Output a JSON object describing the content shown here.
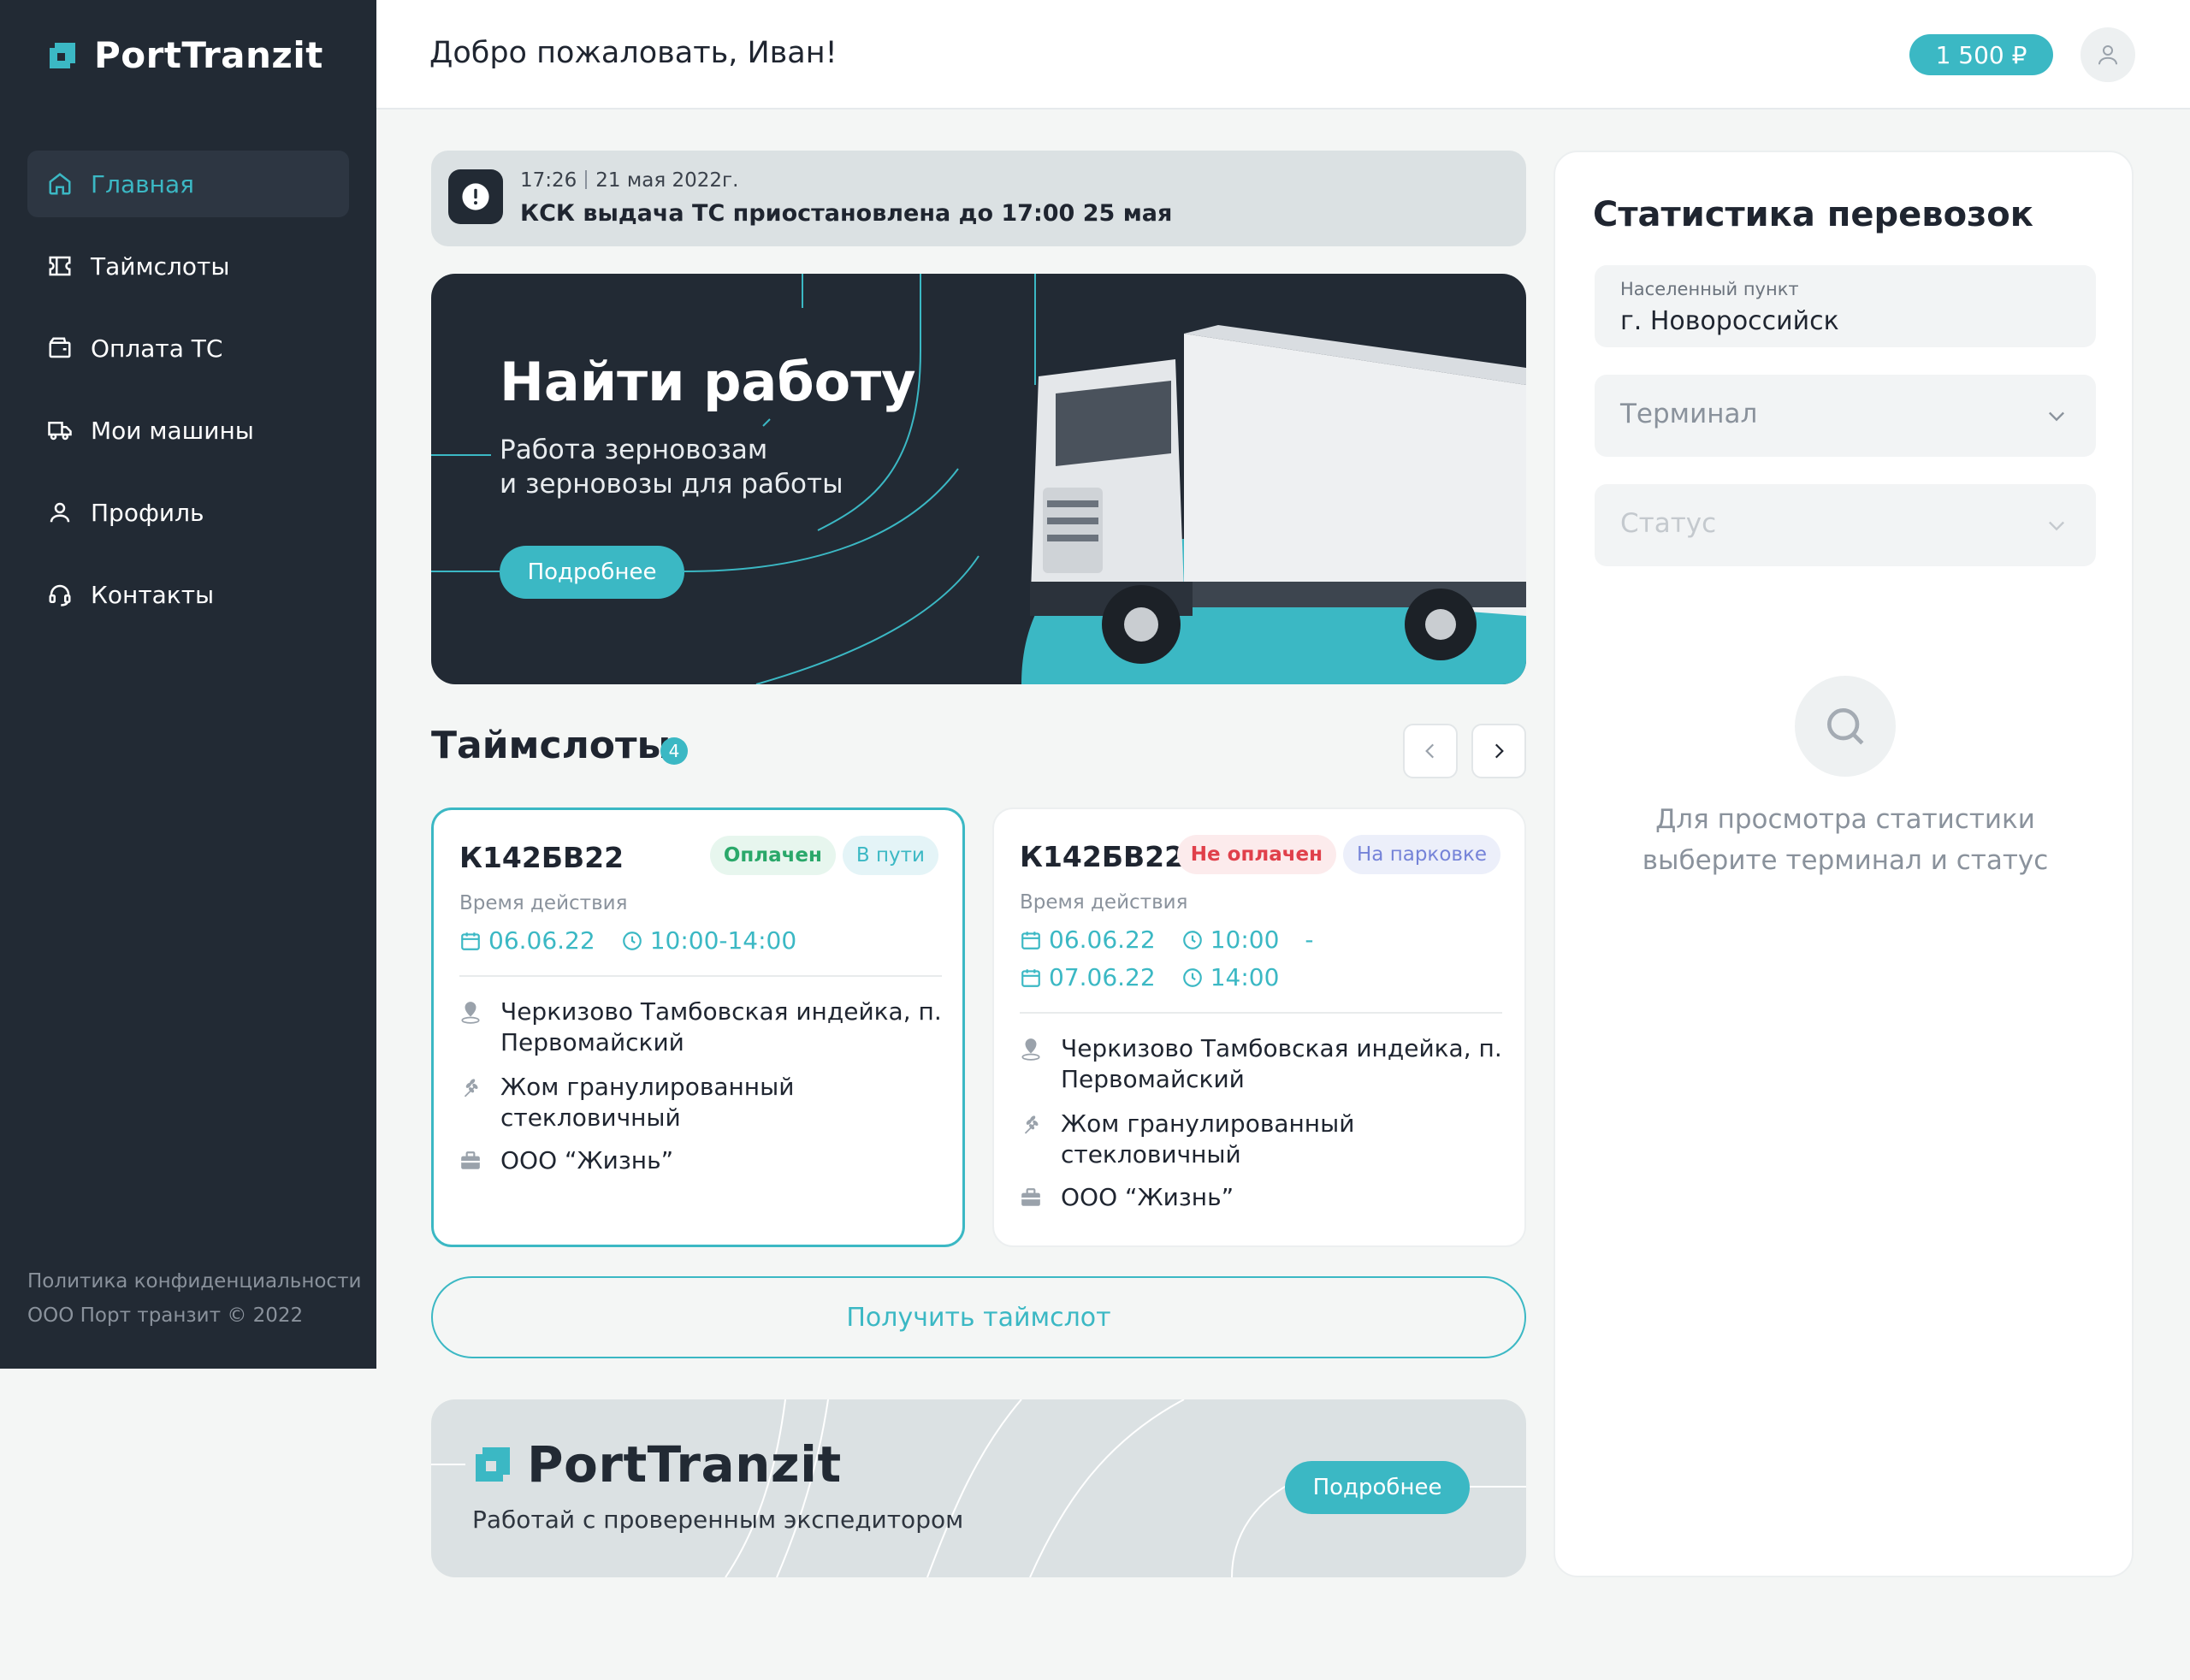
{
  "brand": {
    "name": "PortTranzit"
  },
  "sidebar": {
    "items": [
      {
        "label": "Главная",
        "icon": "home-icon",
        "active": true
      },
      {
        "label": "Таймслоты",
        "icon": "ticket-icon",
        "active": false
      },
      {
        "label": "Оплата ТС",
        "icon": "wallet-icon",
        "active": false
      },
      {
        "label": "Мои машины",
        "icon": "truck-icon",
        "active": false
      },
      {
        "label": "Профиль",
        "icon": "user-icon",
        "active": false
      },
      {
        "label": "Контакты",
        "icon": "headset-icon",
        "active": false
      }
    ],
    "footer": {
      "privacy": "Политика конфиденциальности",
      "copyright": "ООО Порт транзит © 2022"
    }
  },
  "header": {
    "welcome": "Добро пожаловать, Иван!",
    "balance": "1 500 ₽"
  },
  "notice": {
    "time": "17:26",
    "date": "21 мая 2022г.",
    "text": "КСК выдача ТС приостановлена до 17:00 25 мая"
  },
  "banner": {
    "title": "Найти работу",
    "subtitle_line1": "Работа зерновозам",
    "subtitle_line2": "и зерновозы для работы",
    "button": "Подробнее"
  },
  "timeslots": {
    "title": "Таймслоты",
    "count": "4",
    "cards": [
      {
        "plate": "К142БВ22",
        "badge_payment": "Оплачен",
        "badge_status": "В пути",
        "label": "Время действия",
        "date": "06.06.22",
        "time": "10:00-14:00",
        "location": "Черкизово Тамбовская индейка, п. Первомайский",
        "cargo": "Жом гранулированный стекловичный",
        "company": "ООО “Жизнь”"
      },
      {
        "plate": "К142БВ22",
        "badge_payment": "Не оплачен",
        "badge_status": "На парковке",
        "label": "Время действия",
        "date_from": "06.06.22",
        "time_from": "10:00",
        "dash": "-",
        "date_to": "07.06.22",
        "time_to": "14:00",
        "location": "Черкизово Тамбовская индейка, п. Первомайский",
        "cargo": "Жом гранулированный стекловичный",
        "company": "ООО “Жизнь”"
      }
    ],
    "get_button": "Получить таймслот"
  },
  "promo": {
    "brand": "PortTranzit",
    "subtitle": "Работай с проверенным экспедитором",
    "button": "Подробнее"
  },
  "stats": {
    "title": "Статистика перевозок",
    "city_label": "Населенный пункт",
    "city_value": "г. Новороссийск",
    "terminal_placeholder": "Терминал",
    "status_placeholder": "Статус",
    "empty_line1": "Для просмотра статистики",
    "empty_line2": "выберите терминал и статус"
  },
  "colors": {
    "accent": "#3bb8c4",
    "sidebar": "#222a34",
    "paid": "#2aa86a",
    "unpaid": "#e0404b",
    "parking": "#7583d8"
  }
}
